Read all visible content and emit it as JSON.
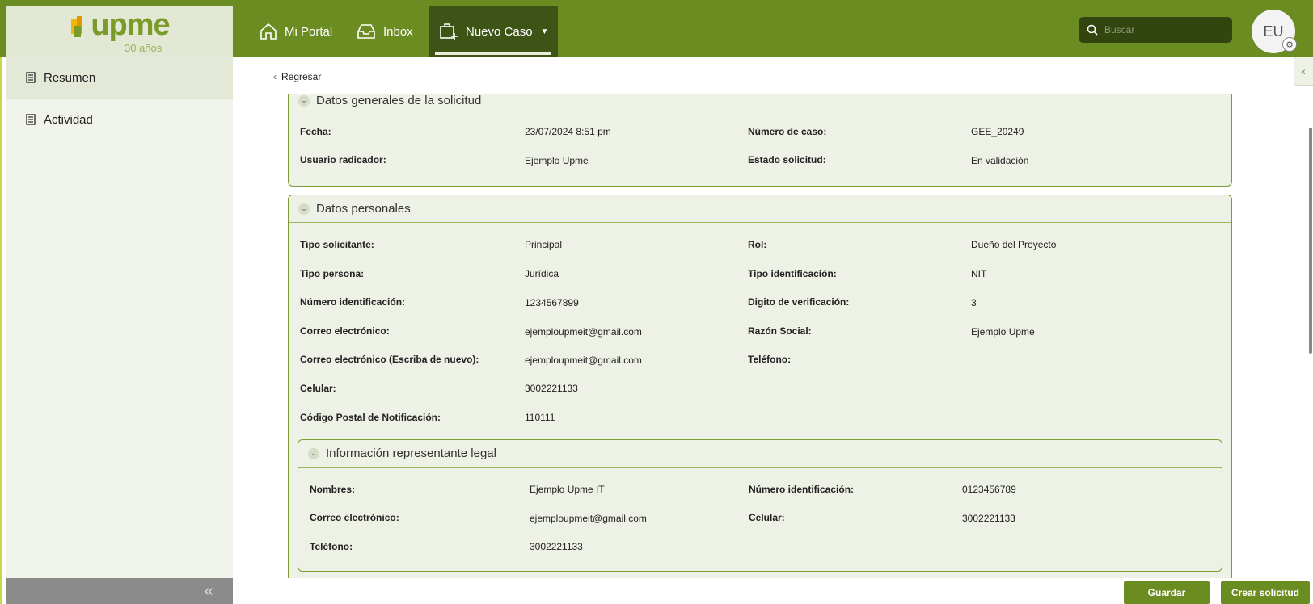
{
  "header": {
    "logo_text": "upme",
    "logo_sub": "30 años",
    "nav": [
      {
        "label": "Mi Portal",
        "icon": "home-icon"
      },
      {
        "label": "Inbox",
        "icon": "inbox-icon"
      },
      {
        "label": "Nuevo Caso",
        "icon": "new-case-icon"
      }
    ],
    "search_placeholder": "Buscar",
    "avatar_initials": "EU"
  },
  "sidebar": {
    "items": [
      {
        "label": "Resumen",
        "active": true
      },
      {
        "label": "Actividad",
        "active": false
      }
    ],
    "collapse_glyph": "«"
  },
  "main": {
    "back_label": "Regresar",
    "general": {
      "title": "Datos generales de la solicitud",
      "fields": [
        {
          "label": "Fecha:",
          "value": "23/07/2024 8:51 pm"
        },
        {
          "label": "Número de caso:",
          "value": "GEE_20249"
        },
        {
          "label": "Usuario radicador:",
          "value": "Ejemplo Upme"
        },
        {
          "label": "Estado solicitud:",
          "value": "En validación"
        }
      ]
    },
    "personal": {
      "title": "Datos personales",
      "fields": [
        {
          "label": "Tipo solicitante:",
          "value": "Principal"
        },
        {
          "label": "Rol:",
          "value": "Dueño del Proyecto"
        },
        {
          "label": "Tipo persona:",
          "value": "Jurídica"
        },
        {
          "label": "Tipo identificación:",
          "value": "NIT"
        },
        {
          "label": "Número identificación:",
          "value": "1234567899"
        },
        {
          "label": "Digito de verificación:",
          "value": "3"
        },
        {
          "label": "Correo electrónico:",
          "value": "ejemploupmeit@gmail.com"
        },
        {
          "label": "Razón Social:",
          "value": "Ejemplo Upme"
        },
        {
          "label": "Correo electrónico (Escriba de nuevo):",
          "value": "ejemploupmeit@gmail.com"
        },
        {
          "label": "Teléfono:",
          "value": ""
        },
        {
          "label": "Celular:",
          "value": "3002221133"
        },
        {
          "label": "Código Postal de Notificación:",
          "value": "110111"
        }
      ]
    },
    "legal": {
      "title": "Información representante legal",
      "fields": [
        {
          "label": "Nombres:",
          "value": "Ejemplo Upme IT"
        },
        {
          "label": "Número identificación:",
          "value": "0123456789"
        },
        {
          "label": "Correo electrónico:",
          "value": "ejemploupmeit@gmail.com"
        },
        {
          "label": "Celular:",
          "value": "3002221133"
        },
        {
          "label": "Teléfono:",
          "value": "3002221133"
        }
      ]
    }
  },
  "footer": {
    "save_label": "Guardar",
    "create_label": "Crear solicitud"
  },
  "colors": {
    "brand_green": "#6b8c21",
    "dark_green": "#3e5416",
    "panel_bg": "#eef2e6"
  }
}
